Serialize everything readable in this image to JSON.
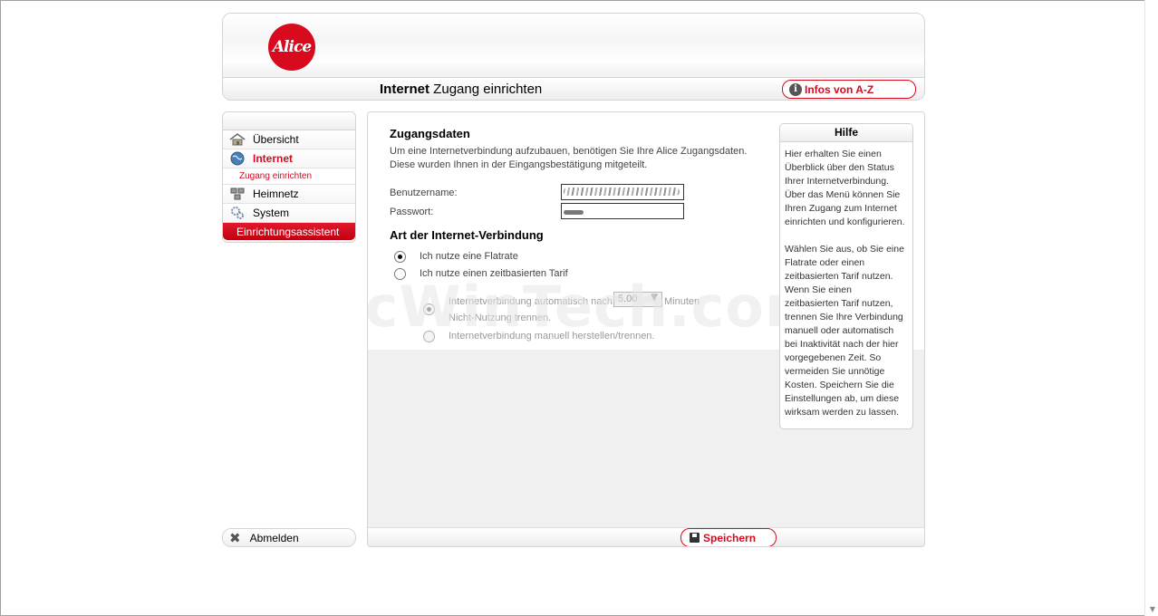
{
  "header": {
    "logo_text": "Alice",
    "title_bold": "Internet",
    "title_rest": " Zugang einrichten",
    "infos_button": "Infos von A-Z"
  },
  "sidebar": {
    "items": [
      {
        "label": "Übersicht",
        "icon": "house-icon"
      },
      {
        "label": "Internet",
        "icon": "globe-icon"
      },
      {
        "label": "Zugang einrichten"
      },
      {
        "label": "Heimnetz",
        "icon": "network-icon"
      },
      {
        "label": "System",
        "icon": "gears-icon"
      },
      {
        "label": "Einrichtungsassistent"
      }
    ],
    "logout": "Abmelden"
  },
  "main": {
    "section1_title": "Zugangsdaten",
    "description": "Um eine Internetverbindung aufzubauen, benötigen Sie Ihre Alice Zugangsdaten. Diese wurden Ihnen in der Eingangsbestätigung mitgeteilt.",
    "username_label": "Benutzername:",
    "password_label": "Passwort:",
    "section2_title": "Art der Internet-Verbindung",
    "radio_flatrate": "Ich nutze eine Flatrate",
    "radio_time": "Ich nutze einen zeitbasierten Tarif",
    "auto_disconnect_a": "Internetverbindung automatisch nach",
    "minutes_value": "5.00",
    "minutes_unit": "Minuten",
    "auto_disconnect_b": "Nicht-Nutzung trennen.",
    "manual_connect": "Internetverbindung manuell herstellen/trennen.",
    "save_button": "Speichern",
    "watermark": "PcWinTech.com"
  },
  "help": {
    "title": "Hilfe",
    "p1": "Hier erhalten Sie einen Überblick über den Status Ihrer Internetverbindung. Über das Menü können Sie Ihren Zugang zum Internet einrichten und konfigurieren.",
    "p2": "Wählen Sie aus, ob Sie eine Flatrate oder einen zeitbasierten Tarif nutzen. Wenn Sie einen zeitbasierten Tarif nutzen, trennen Sie Ihre Verbindung manuell oder automatisch bei Inaktivität nach der hier vorgegebenen Zeit. So vermeiden Sie unnötige Kosten. Speichern Sie die Einstellungen ab, um diese wirksam werden zu lassen."
  },
  "colors": {
    "brand_red": "#d70a1e"
  }
}
